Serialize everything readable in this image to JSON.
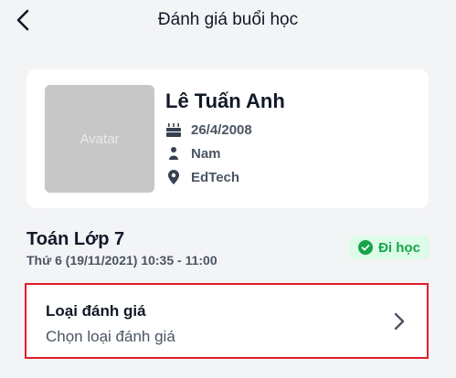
{
  "header": {
    "title": "Đánh giá buổi học"
  },
  "profile": {
    "avatar_text": "Avatar",
    "name": "Lê Tuấn Anh",
    "birthday": "26/4/2008",
    "gender": "Nam",
    "school": "EdTech"
  },
  "lesson": {
    "title": "Toán Lớp 7",
    "time": "Thứ 6 (19/11/2021) 10:35 - 11:00",
    "status": "Đi học"
  },
  "evaluation": {
    "label": "Loại đánh giá",
    "placeholder": "Chọn loại đánh giá"
  },
  "colors": {
    "background": "#f3f4f6",
    "card": "#ffffff",
    "status_green": "#16a34a",
    "status_bg": "#dcfce7",
    "highlight_red": "#e11d2a"
  },
  "icons": [
    "back-arrow-icon",
    "cake-icon",
    "gender-icon",
    "location-pin-icon",
    "check-circle-icon",
    "chevron-right-icon"
  ]
}
